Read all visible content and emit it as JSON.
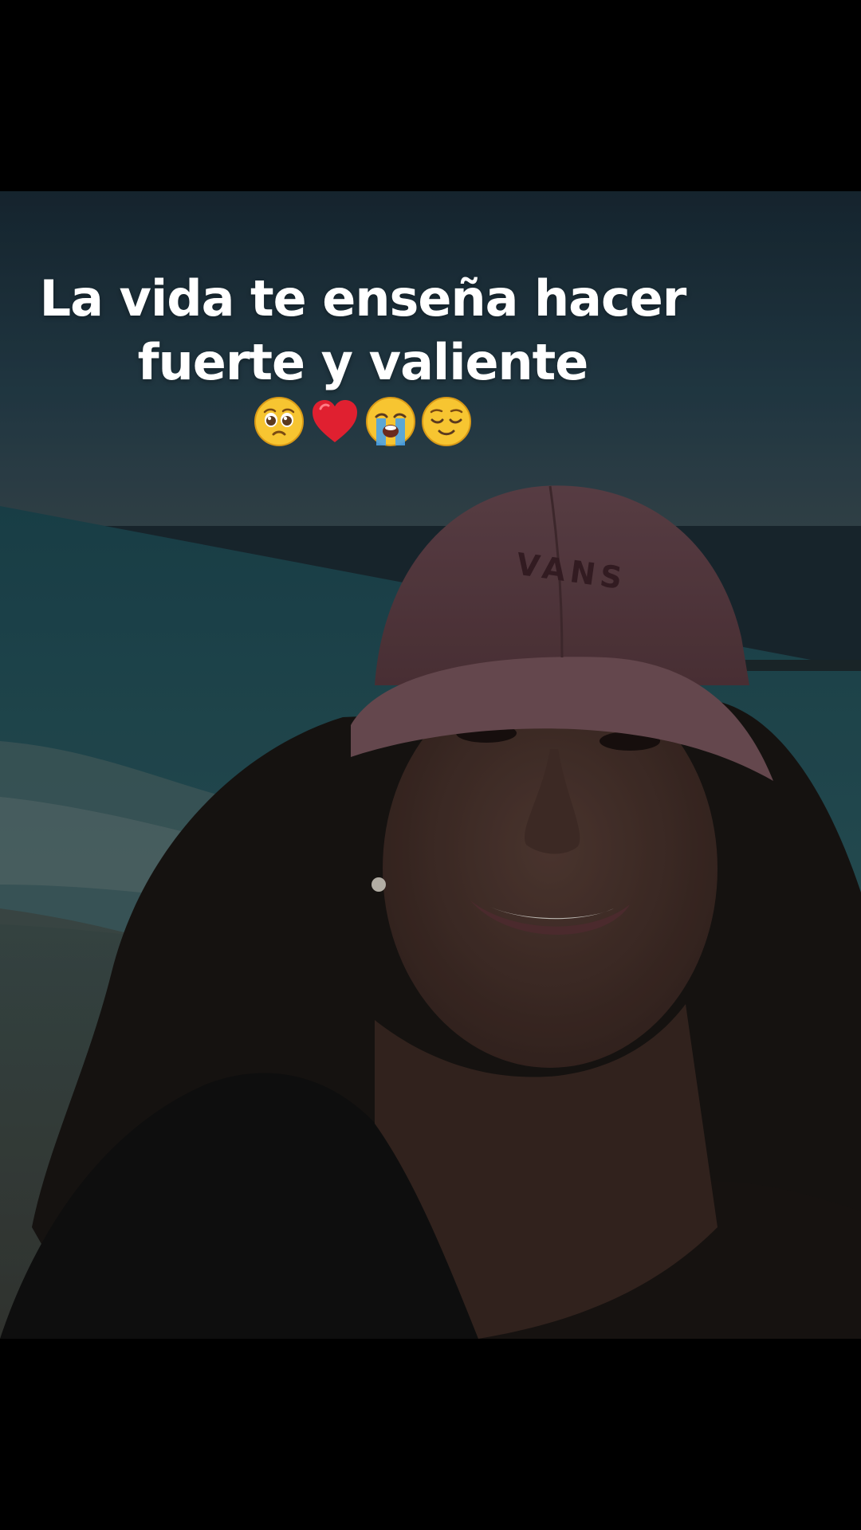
{
  "caption": {
    "line1": "La vida te enseña hacer",
    "line2": "fuerte y valiente"
  },
  "emojis": [
    "pleading-face-icon",
    "red-heart-icon",
    "loudly-crying-face-icon",
    "relieved-face-icon"
  ],
  "photo": {
    "cap_text": "VANS"
  },
  "colors": {
    "background": "#000000",
    "caption_text": "#ffffff"
  }
}
